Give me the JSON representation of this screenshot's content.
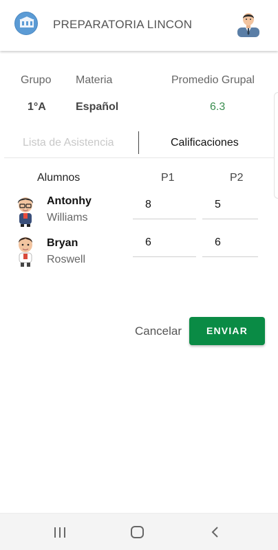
{
  "header": {
    "app_title": "PREPARATORIA LINCON",
    "logo_icon": "school-building-icon",
    "user_icon": "user-avatar-icon"
  },
  "course_info": {
    "group_label": "Grupo",
    "group_value": "1°A",
    "subject_label": "Materia",
    "subject_value": "Español",
    "average_label": "Promedio Grupal",
    "average_value": "6.3",
    "average_color": "#3a8d4f"
  },
  "tabs": [
    {
      "label": "Lista de Asistencia",
      "active": false
    },
    {
      "label": "Calificaciones",
      "active": true
    }
  ],
  "grades_table": {
    "headers": {
      "students": "Alumnos",
      "p1": "P1",
      "p2": "P2"
    },
    "rows": [
      {
        "first_name": "Antonhy",
        "last_name": "Williams",
        "p1": "8",
        "p2": "5"
      },
      {
        "first_name": "Bryan",
        "last_name": "Roswell",
        "p1": "6",
        "p2": "6"
      }
    ]
  },
  "actions": {
    "cancel_label": "Cancelar",
    "send_label": "ENVIAR",
    "send_color": "#0a8b45"
  },
  "system_nav": {
    "recent_icon": "recent-apps-icon",
    "home_icon": "home-icon",
    "back_icon": "back-icon"
  }
}
